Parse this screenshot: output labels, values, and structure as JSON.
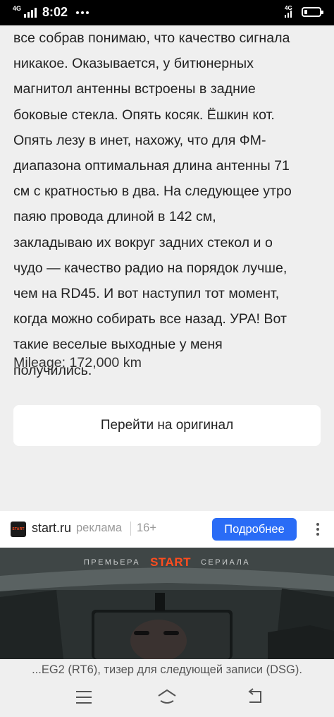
{
  "status_bar": {
    "network_left": "4G",
    "time": "8:02",
    "network_right": "4G"
  },
  "article": {
    "text": "все собрав понимаю, что качество сигнала\nникакое. Оказывается, у битюнерных\nмагнитол антенны встроены в задние\nбоковые стекла. Опять косяк. Ёшкин кот.\nОпять лезу в инет, нахожу, что для ФМ-\nдиапазона оптимальная длина антенны 71\nсм с кратностью в два. На следующее утро\nпаяю провода длиной в 142 см,\nзакладываю их вокруг задних стекол и о\nчудо — качество радио на порядок лучше,\nчем на RD45. И вот наступил тот момент,\nкогда можно собирать все назад. УРА! Вот\nтакие веселые выходные у меня\nполучились.",
    "mileage": "Mileage: 172,000 km",
    "original_button": "Перейти на оригинал"
  },
  "ad": {
    "logo_text": "START",
    "site": "start.ru",
    "label": "реклама",
    "age": "16+",
    "cta": "Подробнее",
    "banner": {
      "left_text": "ПРЕМЬЕРА",
      "brand": "START",
      "right_text": "СЕРИАЛА"
    }
  },
  "caption": "...EG2 (RT6), тизер для следующей записи (DSG).",
  "navigation": {
    "icons": [
      "menu-icon",
      "home-icon",
      "back-icon"
    ]
  },
  "colors": {
    "cta_blue": "#2a6cf6",
    "brand_orange": "#ff4d1f",
    "page_bg": "#efefef"
  }
}
